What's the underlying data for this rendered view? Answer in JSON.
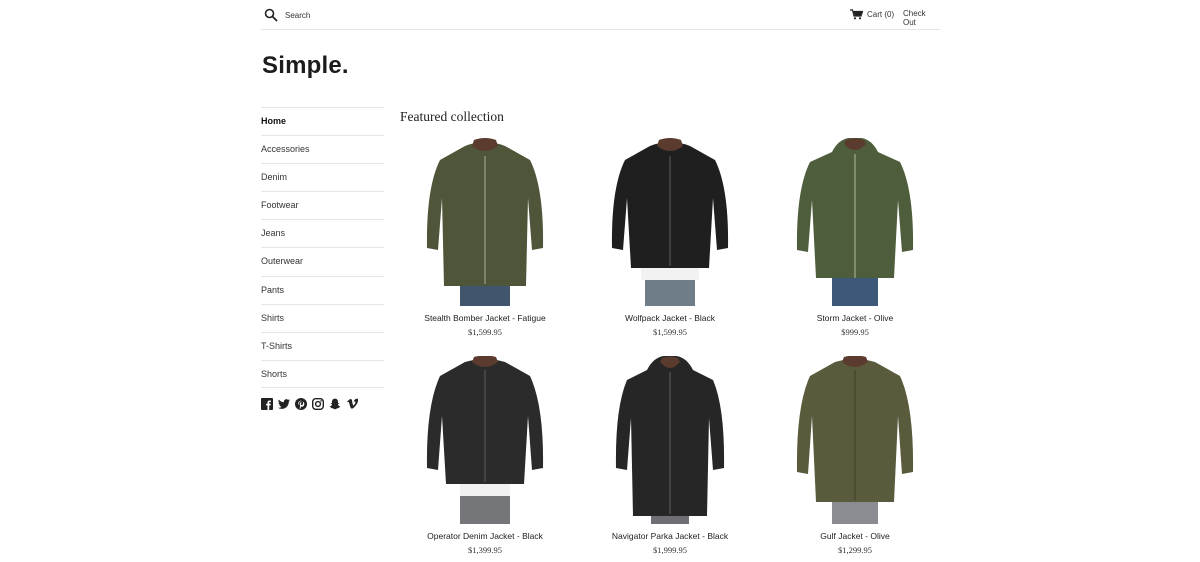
{
  "header": {
    "search_placeholder": "Search",
    "cart_label": "Cart (0)",
    "checkout_label": "Check Out"
  },
  "logo": "Simple.",
  "sidebar": {
    "items": [
      {
        "label": "Home",
        "active": true
      },
      {
        "label": "Accessories"
      },
      {
        "label": "Denim"
      },
      {
        "label": "Footwear"
      },
      {
        "label": "Jeans"
      },
      {
        "label": "Outerwear"
      },
      {
        "label": "Pants"
      },
      {
        "label": "Shirts"
      },
      {
        "label": "T-Shirts"
      },
      {
        "label": "Shorts"
      }
    ],
    "social_icons": [
      "facebook-icon",
      "twitter-icon",
      "pinterest-icon",
      "instagram-icon",
      "snapchat-icon",
      "vimeo-icon"
    ]
  },
  "main": {
    "title": "Featured collection",
    "products": [
      {
        "name": "Stealth Bomber Jacket - Fatigue",
        "price": "$1,599.95",
        "color": "#4f5538"
      },
      {
        "name": "Wolfpack Jacket - Black",
        "price": "$1,599.95",
        "color": "#1f1f1f"
      },
      {
        "name": "Storm Jacket - Olive",
        "price": "$999.95",
        "color": "#4e5d3c"
      },
      {
        "name": "Operator Denim Jacket - Black",
        "price": "$1,399.95",
        "color": "#2b2b2b"
      },
      {
        "name": "Navigator Parka Jacket - Black",
        "price": "$1,999.95",
        "color": "#262626"
      },
      {
        "name": "Gulf Jacket - Olive",
        "price": "$1,299.95",
        "color": "#5a5a3c"
      }
    ]
  }
}
